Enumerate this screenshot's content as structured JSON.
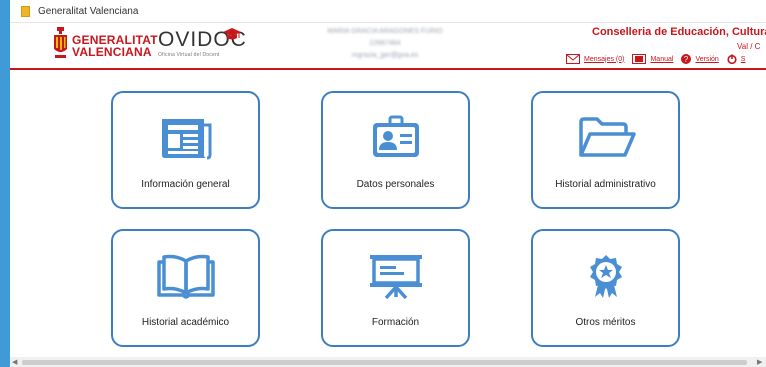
{
  "window": {
    "title": "Generalitat Valenciana"
  },
  "header": {
    "gv_logo_text": "GENERALITAT\nVALENCIANA",
    "app_name": "OVIDOC",
    "app_subtitle": "Oficina Virtual del Docent",
    "user_lines": [
      "MARIA GRACIA ARAGONES FURIO",
      "22667464",
      "mgrazia_ger@gva.es"
    ],
    "conselleria": "Conselleria de Educación, Cultura y Depo",
    "language": "Val  /  C",
    "links": [
      {
        "label": "Mensajes (0)",
        "icon": "envelope-icon"
      },
      {
        "label": "Manual",
        "icon": "book-icon"
      },
      {
        "label": "Versión",
        "icon": "help-icon"
      },
      {
        "label": "S",
        "icon": "power-icon"
      }
    ]
  },
  "tiles": [
    {
      "label": "Información general",
      "icon": "newspaper-icon"
    },
    {
      "label": "Datos personales",
      "icon": "id-card-icon"
    },
    {
      "label": "Historial administrativo",
      "icon": "folder-icon"
    },
    {
      "label": "Historial académico",
      "icon": "open-book-icon"
    },
    {
      "label": "Formación",
      "icon": "presentation-board-icon"
    },
    {
      "label": "Otros méritos",
      "icon": "award-rosette-icon"
    }
  ],
  "colors": {
    "brand_red": "#c8161d",
    "tile_blue": "#3d7ec2",
    "icon_blue": "#4a8fd4",
    "desktop_blue": "#3f9ad6"
  }
}
